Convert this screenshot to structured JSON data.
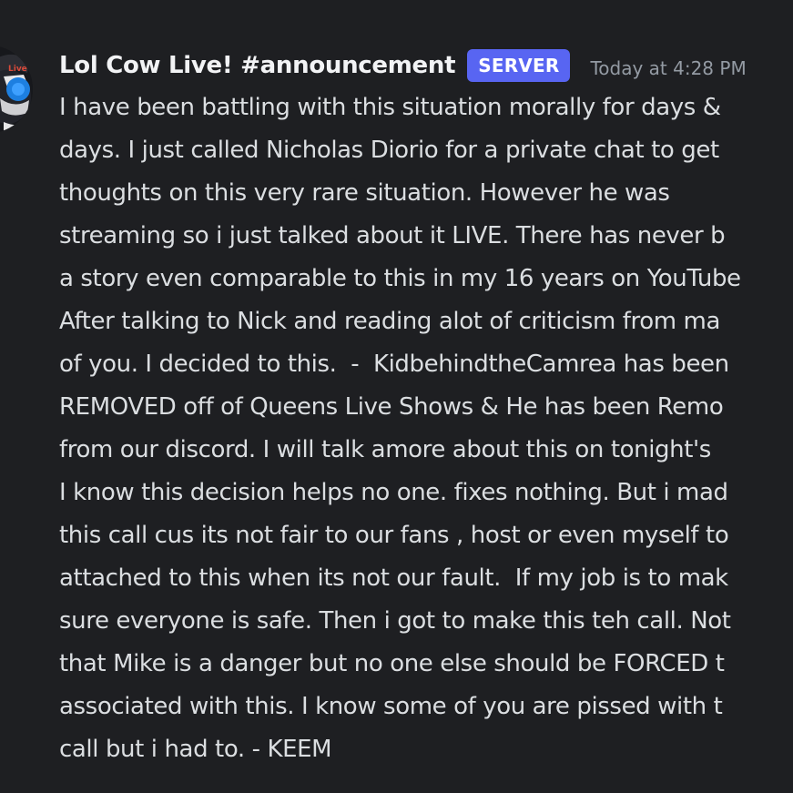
{
  "colors": {
    "background": "#1e1f22",
    "username": "#f2f3f5",
    "tag_bg": "#5865f2",
    "timestamp": "#949ba4",
    "text": "#dbdee1"
  },
  "message": {
    "avatar_icon": "avatar-image",
    "username": "Lol Cow Live! #announcement",
    "tag": "SERVER",
    "timestamp": "Today at 4:28 PM",
    "lines": [
      "I have been battling with this situation morally for days &",
      "days. I just called Nicholas Diorio for a private chat to get",
      "thoughts on this very rare situation. However he was",
      "streaming so i just talked about it LIVE. There has never b",
      "a story even comparable to this in my 16 years on YouTube",
      "After talking to Nick and reading alot of criticism from ma",
      "of you. I decided to this.  -  KidbehindtheCamrea has been",
      "REMOVED off of Queens Live Shows & He has been Remo",
      "from our discord. I will talk amore about this on tonight's",
      "I know this decision helps no one. fixes nothing. But i mad",
      "this call cus its not fair to our fans , host or even myself to",
      "attached to this when its not our fault.  If my job is to mak",
      "sure everyone is safe. Then i got to make this teh call. Not",
      "that Mike is a danger but no one else should be FORCED t",
      "associated with this. I know some of you are pissed with t",
      "call but i had to. - KEEM"
    ]
  }
}
